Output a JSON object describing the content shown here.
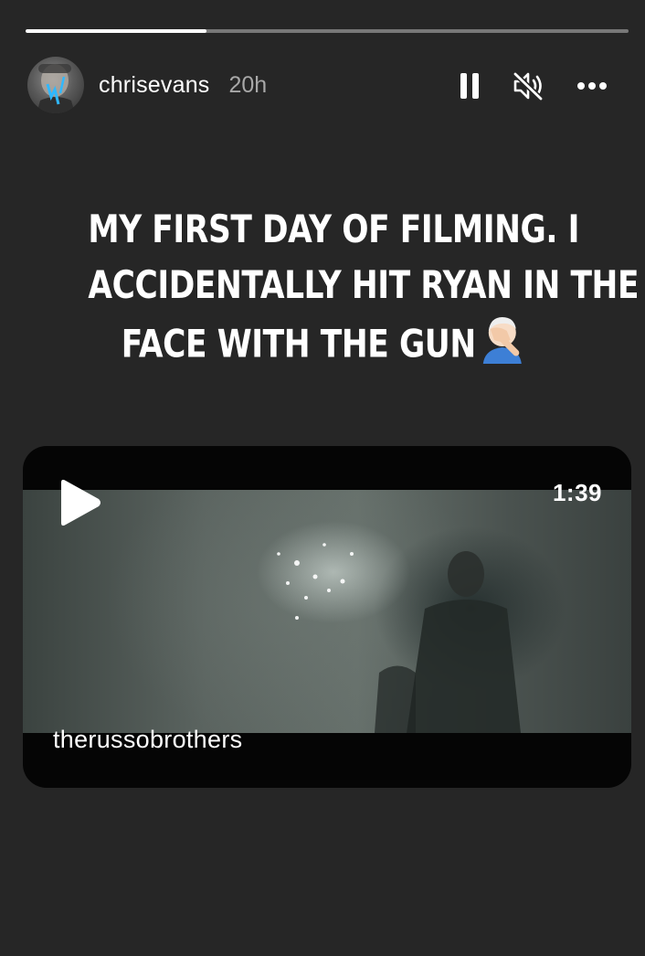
{
  "progress": {
    "fraction": 0.3
  },
  "header": {
    "username": "chrisevans",
    "timestamp": "20h",
    "controls": {
      "pause_icon": "pause-icon",
      "mute_icon": "speaker-muted-icon",
      "more_icon": "more-horizontal-icon"
    }
  },
  "caption": {
    "lines": [
      "MY FIRST DAY OF FILMING. I",
      "ACCIDENTALLY HIT RYAN IN THE",
      "FACE WITH THE GUN"
    ],
    "emoji": "🤦🏻‍♂️"
  },
  "video": {
    "play_icon": "play-icon",
    "duration": "1:39",
    "source": "therussobrothers"
  },
  "colors": {
    "background": "#262626",
    "text": "#ffffff",
    "muted_text": "#a8a8a8"
  }
}
